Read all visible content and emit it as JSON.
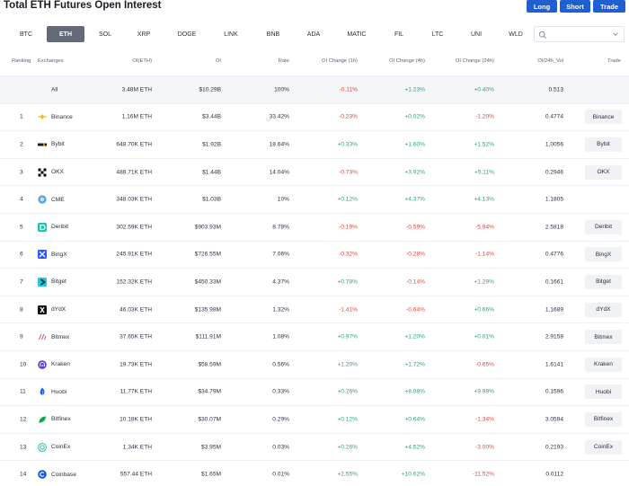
{
  "header": {
    "title": "Total ETH Futures Open Interest",
    "buttons": {
      "long": "Long",
      "short": "Short",
      "trade": "Trade"
    }
  },
  "tabs": [
    "BTC",
    "ETH",
    "SOL",
    "XRP",
    "DOGE",
    "LINK",
    "BNB",
    "ADA",
    "MATIC",
    "FIL",
    "LTC",
    "UNI",
    "WLD"
  ],
  "active_tab": "ETH",
  "search": {
    "value": "",
    "placeholder": ""
  },
  "colors": {
    "accent": "#1f5fd1",
    "active_tab": "#646b78",
    "positive": "#2fa36b",
    "negative": "#e0453c"
  },
  "table": {
    "headers": {
      "ranking": "Ranking",
      "exchanges": "Exchanges",
      "oi_eth": "OI(ETH)",
      "oi": "OI",
      "rate": "Rate",
      "chg1h": "OI Change (1h)",
      "chg4h": "OI Change (4h)",
      "chg24h": "OI Change (24h)",
      "vol": "OI/24h_Vol",
      "trade": "Trade"
    },
    "all": {
      "name": "All",
      "oi_eth": "3.48M ETH",
      "oi": "$10.29B",
      "rate": "100%",
      "chg1h": "-0.11%",
      "chg4h": "+1.23%",
      "chg24h": "+0.40%",
      "vol": "0.513"
    },
    "rows": [
      {
        "rank": "1",
        "name": "Binance",
        "icon": "binance-icon",
        "oi_eth": "1.16M ETH",
        "oi": "$3.44B",
        "rate": "33.42%",
        "chg1h": "-0.23%",
        "chg4h": "+0.02%",
        "chg24h": "-1.20%",
        "vol": "0.4774",
        "trade": "Binance"
      },
      {
        "rank": "2",
        "name": "Bybit",
        "icon": "bybit-icon",
        "oi_eth": "648.70K ETH",
        "oi": "$1.92B",
        "rate": "18.64%",
        "chg1h": "+0.33%",
        "chg4h": "+1.60%",
        "chg24h": "+1.52%",
        "vol": "1.0056",
        "trade": "Bybit"
      },
      {
        "rank": "3",
        "name": "OKX",
        "icon": "okx-icon",
        "oi_eth": "488.71K ETH",
        "oi": "$1.44B",
        "rate": "14.04%",
        "chg1h": "-0.73%",
        "chg4h": "+3.92%",
        "chg24h": "+5.11%",
        "vol": "0.2946",
        "trade": "OKX"
      },
      {
        "rank": "4",
        "name": "CME",
        "icon": "cme-icon",
        "oi_eth": "348.03K ETH",
        "oi": "$1.03B",
        "rate": "10%",
        "chg1h": "+0.12%",
        "chg4h": "+4.37%",
        "chg24h": "+4.13%",
        "vol": "1.1805",
        "trade": ""
      },
      {
        "rank": "5",
        "name": "Deribit",
        "icon": "deribit-icon",
        "oi_eth": "302.59K ETH",
        "oi": "$903.93M",
        "rate": "8.78%",
        "chg1h": "-0.19%",
        "chg4h": "-0.59%",
        "chg24h": "-5.94%",
        "vol": "2.5818",
        "trade": "Deribit"
      },
      {
        "rank": "6",
        "name": "BingX",
        "icon": "bingx-icon",
        "oi_eth": "245.91K ETH",
        "oi": "$726.55M",
        "rate": "7.06%",
        "chg1h": "-0.32%",
        "chg4h": "-0.28%",
        "chg24h": "-1.14%",
        "vol": "0.4776",
        "trade": "BingX"
      },
      {
        "rank": "7",
        "name": "Bitget",
        "icon": "bitget-icon",
        "oi_eth": "152.32K ETH",
        "oi": "$450.33M",
        "rate": "4.37%",
        "chg1h": "+0.78%",
        "chg4h": "-0.14%",
        "chg24h": "+1.29%",
        "vol": "0.1661",
        "trade": "Bitget"
      },
      {
        "rank": "8",
        "name": "dYdX",
        "icon": "dydx-icon",
        "oi_eth": "46.03K ETH",
        "oi": "$135.98M",
        "rate": "1.32%",
        "chg1h": "-1.41%",
        "chg4h": "-0.64%",
        "chg24h": "+0.66%",
        "vol": "1.1689",
        "trade": "dYdX"
      },
      {
        "rank": "9",
        "name": "Bitmex",
        "icon": "bitmex-icon",
        "oi_eth": "37.65K ETH",
        "oi": "$111.91M",
        "rate": "1.08%",
        "chg1h": "+0.97%",
        "chg4h": "+1.20%",
        "chg24h": "+0.01%",
        "vol": "2.9158",
        "trade": "Bitmex"
      },
      {
        "rank": "10",
        "name": "Kraken",
        "icon": "kraken-icon",
        "oi_eth": "19.73K ETH",
        "oi": "$58.59M",
        "rate": "0.56%",
        "chg1h": "+1.20%",
        "chg4h": "+1.72%",
        "chg24h": "-0.65%",
        "vol": "1.6141",
        "trade": "Kraken"
      },
      {
        "rank": "11",
        "name": "Huobi",
        "icon": "huobi-icon",
        "oi_eth": "11.77K ETH",
        "oi": "$34.79M",
        "rate": "0.33%",
        "chg1h": "+0.26%",
        "chg4h": "+8.08%",
        "chg24h": "+9.99%",
        "vol": "0.1596",
        "trade": "Huobi"
      },
      {
        "rank": "12",
        "name": "Bitfinex",
        "icon": "bitfinex-icon",
        "oi_eth": "10.18K ETH",
        "oi": "$30.07M",
        "rate": "0.29%",
        "chg1h": "+0.12%",
        "chg4h": "+0.64%",
        "chg24h": "-1.34%",
        "vol": "3.0594",
        "trade": "Bitfinex"
      },
      {
        "rank": "13",
        "name": "CoinEx",
        "icon": "coinex-icon",
        "oi_eth": "1.34K ETH",
        "oi": "$3.95M",
        "rate": "0.03%",
        "chg1h": "+0.26%",
        "chg4h": "+4.52%",
        "chg24h": "-3.00%",
        "vol": "0.2193",
        "trade": "CoinEx"
      },
      {
        "rank": "14",
        "name": "Coinbase",
        "icon": "coinbase-icon",
        "oi_eth": "557.44 ETH",
        "oi": "$1.65M",
        "rate": "0.01%",
        "chg1h": "+2.55%",
        "chg4h": "+10.62%",
        "chg24h": "-11.52%",
        "vol": "0.0112",
        "trade": ""
      }
    ]
  }
}
